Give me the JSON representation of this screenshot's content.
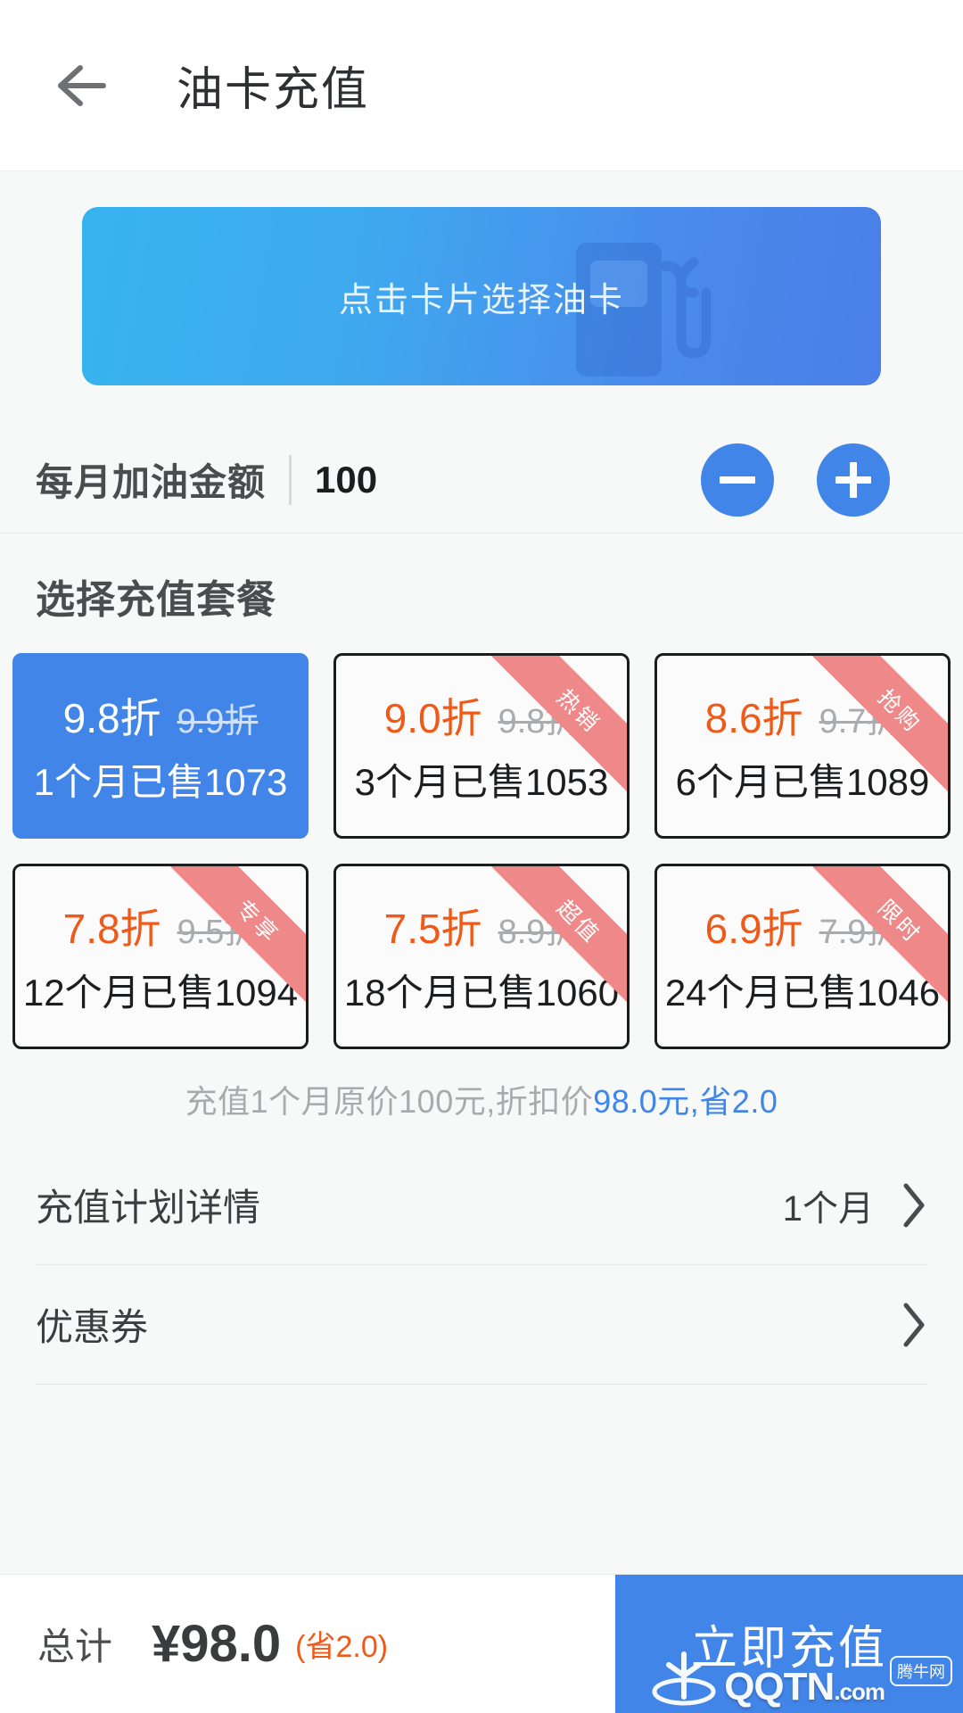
{
  "header": {
    "back_icon": "arrow-left-icon",
    "title": "油卡充值"
  },
  "card_banner": {
    "hint": "点击卡片选择油卡",
    "watermark_icon": "fuel-pump-icon",
    "gradient_from": "#37b4ef",
    "gradient_to": "#4a7fe8"
  },
  "amount": {
    "label": "每月加油金额",
    "value": "100",
    "minus_icon": "minus-icon",
    "plus_icon": "plus-icon",
    "accent": "#4285e8"
  },
  "packages": {
    "section_title": "选择充值套餐",
    "items": [
      {
        "discount": "9.8折",
        "original": "9.9折",
        "sub": "1个月已售1073",
        "ribbon": "",
        "selected": true
      },
      {
        "discount": "9.0折",
        "original": "9.8折",
        "sub": "3个月已售1053",
        "ribbon": "热销",
        "selected": false
      },
      {
        "discount": "8.6折",
        "original": "9.7折",
        "sub": "6个月已售1089",
        "ribbon": "抢购",
        "selected": false
      },
      {
        "discount": "7.8折",
        "original": "9.5折",
        "sub": "12个月已售1094",
        "ribbon": "专享",
        "selected": false
      },
      {
        "discount": "7.5折",
        "original": "8.9折",
        "sub": "18个月已售1060",
        "ribbon": "超值",
        "selected": false
      },
      {
        "discount": "6.9折",
        "original": "7.9折",
        "sub": "24个月已售1046",
        "ribbon": "限时",
        "selected": false
      }
    ],
    "ribbon_color": "#ef8888",
    "discount_color": "#f05a19"
  },
  "summary": {
    "prefix": "充值1个月原价100元,折扣价",
    "highlight": "98.0元,省2.0",
    "highlight_color": "#3f86e8"
  },
  "rows": [
    {
      "label": "充值计划详情",
      "value": "1个月",
      "chevron": "chevron-right-icon"
    },
    {
      "label": "优惠券",
      "value": "",
      "chevron": "chevron-right-icon"
    }
  ],
  "bottom": {
    "total_label": "总计",
    "total_amount": "¥98.0",
    "total_save": "(省2.0)",
    "pay_button": "立即充值",
    "save_color": "#f05a19",
    "button_color": "#4285e8"
  },
  "watermark": {
    "badge": "腾牛网",
    "site": "QQTN",
    "tld": ".com"
  }
}
